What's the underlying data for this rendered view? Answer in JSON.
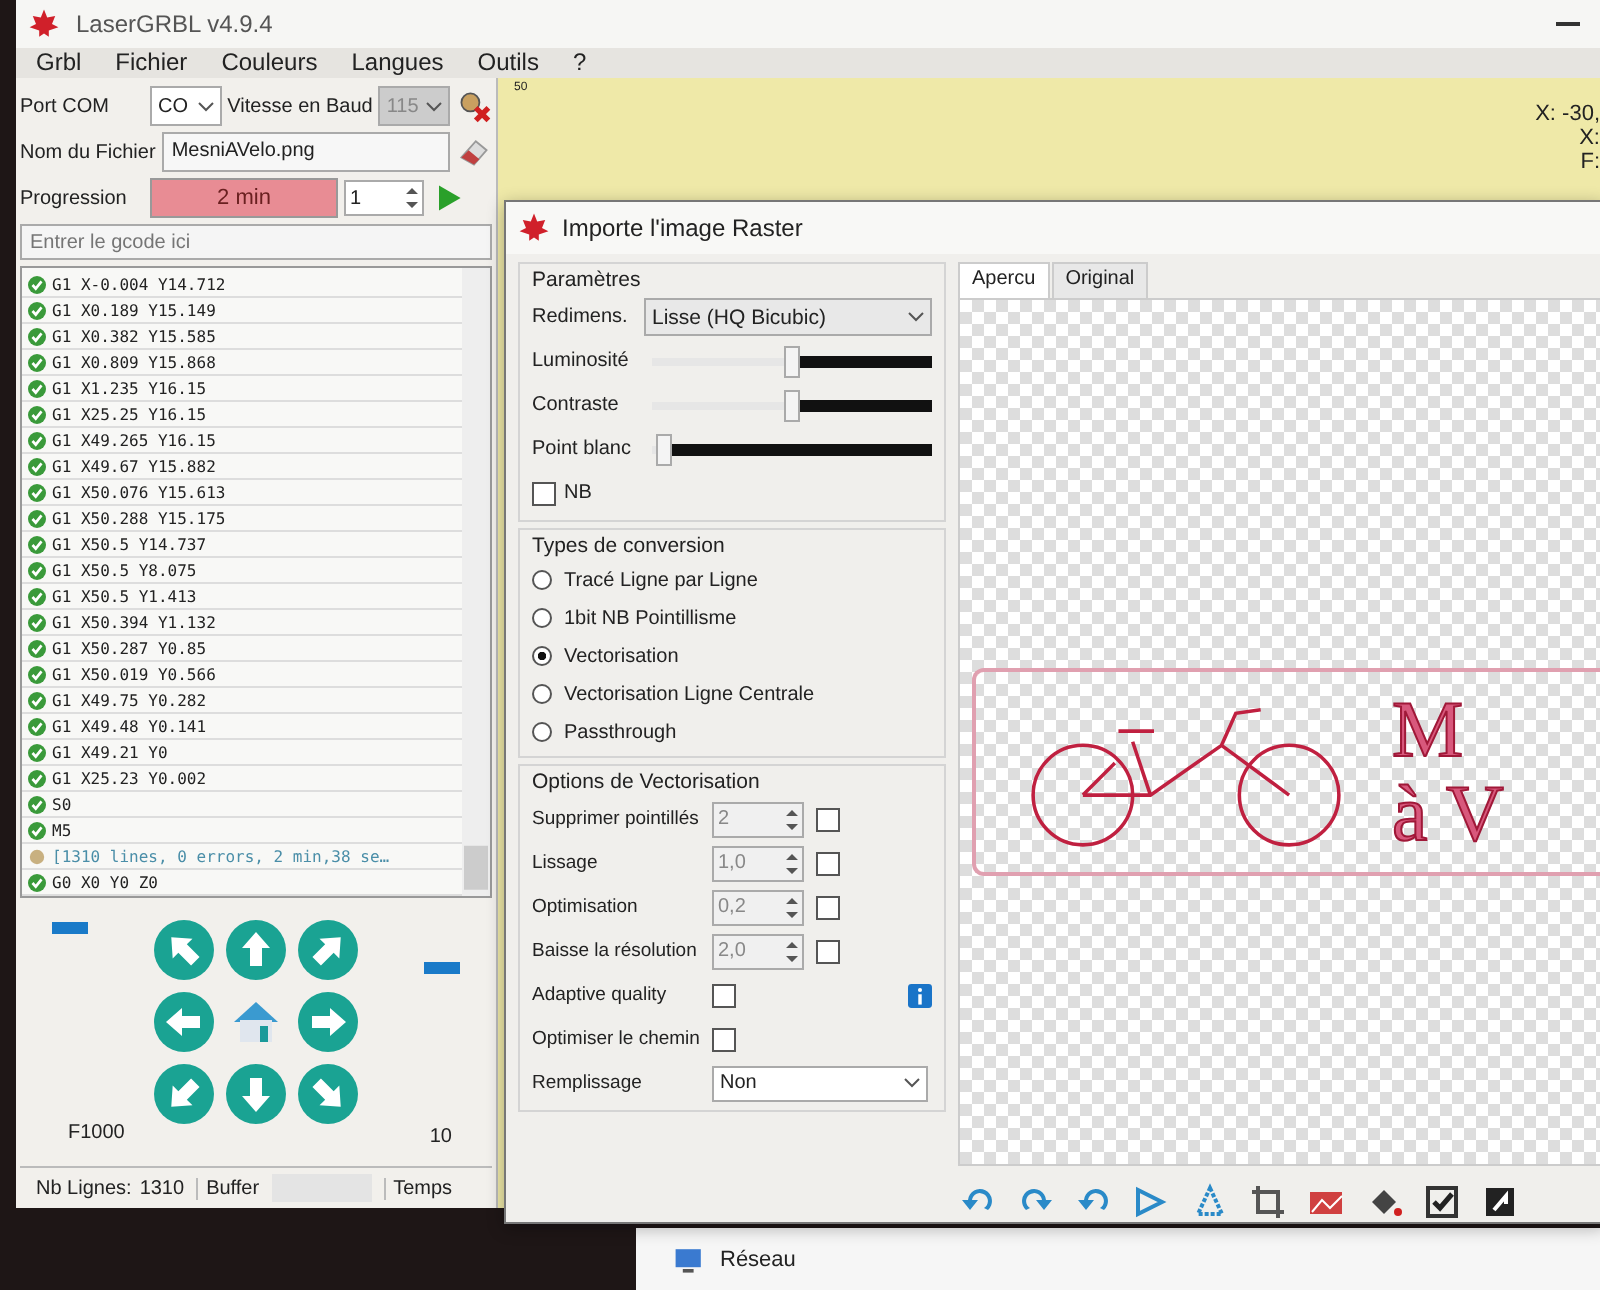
{
  "window": {
    "title": "LaserGRBL v4.9.4"
  },
  "menu": [
    "Grbl",
    "Fichier",
    "Couleurs",
    "Langues",
    "Outils",
    "?"
  ],
  "connection": {
    "port_label": "Port COM",
    "port_value": "CO",
    "baud_label": "Vitesse en Baud",
    "baud_value": "115"
  },
  "file": {
    "label": "Nom du Fichier",
    "value": "MesniAVelo.png"
  },
  "progress": {
    "label": "Progression",
    "text": "2 min",
    "level": 1,
    "copies": "1"
  },
  "gcode_input": {
    "placeholder": "Entrer le gcode ici"
  },
  "log": [
    {
      "text": "G1 X-0.004 Y14.712",
      "kind": "ok"
    },
    {
      "text": "G1 X0.189 Y15.149",
      "kind": "ok"
    },
    {
      "text": "G1 X0.382 Y15.585",
      "kind": "ok"
    },
    {
      "text": "G1 X0.809 Y15.868",
      "kind": "ok"
    },
    {
      "text": "G1 X1.235 Y16.15",
      "kind": "ok"
    },
    {
      "text": "G1 X25.25 Y16.15",
      "kind": "ok"
    },
    {
      "text": "G1 X49.265 Y16.15",
      "kind": "ok"
    },
    {
      "text": "G1 X49.67 Y15.882",
      "kind": "ok"
    },
    {
      "text": "G1 X50.076 Y15.613",
      "kind": "ok"
    },
    {
      "text": "G1 X50.288 Y15.175",
      "kind": "ok"
    },
    {
      "text": "G1 X50.5 Y14.737",
      "kind": "ok"
    },
    {
      "text": "G1 X50.5 Y8.075",
      "kind": "ok"
    },
    {
      "text": "G1 X50.5 Y1.413",
      "kind": "ok"
    },
    {
      "text": "G1 X50.394 Y1.132",
      "kind": "ok"
    },
    {
      "text": "G1 X50.287 Y0.85",
      "kind": "ok"
    },
    {
      "text": "G1 X50.019 Y0.566",
      "kind": "ok"
    },
    {
      "text": "G1 X49.75 Y0.282",
      "kind": "ok"
    },
    {
      "text": "G1 X49.48 Y0.141",
      "kind": "ok"
    },
    {
      "text": "G1 X49.21 Y0",
      "kind": "ok"
    },
    {
      "text": "G1 X25.23 Y0.002",
      "kind": "ok"
    },
    {
      "text": "S0",
      "kind": "ok"
    },
    {
      "text": "M5",
      "kind": "ok"
    },
    {
      "text": "[1310 lines, 0 errors, 2 min,38 se…",
      "kind": "info"
    },
    {
      "text": "G0 X0 Y0 Z0",
      "kind": "ok"
    }
  ],
  "jog": {
    "feed": "F1000",
    "step": "10",
    "feed_slider": {
      "level": 0.95
    },
    "step_slider": {
      "level": 0.7
    }
  },
  "status_bar": {
    "lines_label": "Nb Lignes:",
    "lines_value": "1310",
    "buffer_label": "Buffer",
    "time_label": "Temps"
  },
  "canvas": {
    "ruler_label": "50",
    "coords": [
      "X: -30,",
      "X:",
      "F:"
    ]
  },
  "dialog": {
    "title": "Importe l'image Raster",
    "parameters": {
      "title": "Paramètres",
      "resize_label": "Redimens.",
      "resize_value": "Lisse (HQ Bicubic)",
      "sliders": [
        {
          "label": "Luminosité",
          "level": 0.5
        },
        {
          "label": "Contraste",
          "level": 0.5
        },
        {
          "label": "Point blanc",
          "level": 0.04
        }
      ],
      "bw": {
        "label": "NB",
        "checked": false
      }
    },
    "conversion": {
      "title": "Types de conversion",
      "options": [
        {
          "label": "Tracé Ligne par Ligne",
          "selected": false
        },
        {
          "label": "1bit NB Pointillisme",
          "selected": false
        },
        {
          "label": "Vectorisation",
          "selected": true
        },
        {
          "label": "Vectorisation Ligne Centrale",
          "selected": false
        },
        {
          "label": "Passthrough",
          "selected": false
        }
      ]
    },
    "vector_options": {
      "title": "Options de Vectorisation",
      "rows": [
        {
          "kind": "spin",
          "label": "Supprimer pointillés",
          "value": "2",
          "checked": false
        },
        {
          "kind": "spin",
          "label": "Lissage",
          "value": "1,0",
          "checked": false
        },
        {
          "kind": "spin",
          "label": "Optimisation",
          "value": "0,2",
          "checked": false
        },
        {
          "kind": "spin",
          "label": "Baisse la résolution",
          "value": "2,0",
          "checked": false
        },
        {
          "kind": "check",
          "label": "Adaptive quality",
          "checked": false,
          "info": true
        },
        {
          "kind": "check",
          "label": "Optimiser le chemin",
          "checked": false,
          "info": false
        },
        {
          "kind": "select",
          "label": "Remplissage",
          "value": "Non"
        }
      ]
    },
    "preview_tabs": [
      {
        "label": "Apercu",
        "selected": true
      },
      {
        "label": "Original",
        "selected": false
      }
    ],
    "preview_text": [
      "M",
      "à V"
    ]
  },
  "taskbar_item": {
    "label": "Réseau"
  }
}
